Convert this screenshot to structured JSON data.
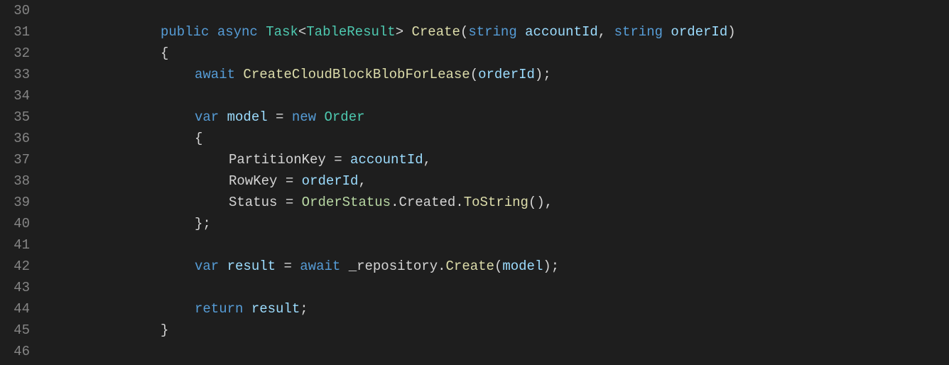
{
  "gutter": {
    "start": 30,
    "end": 46
  },
  "code": {
    "lines": [
      {
        "indent": "indent1",
        "tokens": []
      },
      {
        "indent": "indent1",
        "tokens": [
          {
            "t": "public",
            "c": "tok-keyword"
          },
          {
            "t": " ",
            "c": "tok-default"
          },
          {
            "t": "async",
            "c": "tok-keyword"
          },
          {
            "t": " ",
            "c": "tok-default"
          },
          {
            "t": "Task",
            "c": "tok-type"
          },
          {
            "t": "<",
            "c": "tok-default"
          },
          {
            "t": "TableResult",
            "c": "tok-type"
          },
          {
            "t": "> ",
            "c": "tok-default"
          },
          {
            "t": "Create",
            "c": "tok-method"
          },
          {
            "t": "(",
            "c": "tok-default"
          },
          {
            "t": "string",
            "c": "tok-keyword"
          },
          {
            "t": " ",
            "c": "tok-default"
          },
          {
            "t": "accountId",
            "c": "tok-param"
          },
          {
            "t": ", ",
            "c": "tok-default"
          },
          {
            "t": "string",
            "c": "tok-keyword"
          },
          {
            "t": " ",
            "c": "tok-default"
          },
          {
            "t": "orderId",
            "c": "tok-param"
          },
          {
            "t": ")",
            "c": "tok-default"
          }
        ]
      },
      {
        "indent": "indent1",
        "tokens": [
          {
            "t": "{",
            "c": "tok-default"
          }
        ]
      },
      {
        "indent": "indent2",
        "tokens": [
          {
            "t": "await",
            "c": "tok-keyword"
          },
          {
            "t": " ",
            "c": "tok-default"
          },
          {
            "t": "CreateCloudBlockBlobForLease",
            "c": "tok-method"
          },
          {
            "t": "(",
            "c": "tok-default"
          },
          {
            "t": "orderId",
            "c": "tok-param"
          },
          {
            "t": ");",
            "c": "tok-default"
          }
        ]
      },
      {
        "indent": "indent2",
        "tokens": []
      },
      {
        "indent": "indent2",
        "tokens": [
          {
            "t": "var",
            "c": "tok-keyword"
          },
          {
            "t": " ",
            "c": "tok-default"
          },
          {
            "t": "model",
            "c": "tok-var"
          },
          {
            "t": " = ",
            "c": "tok-default"
          },
          {
            "t": "new",
            "c": "tok-keyword"
          },
          {
            "t": " ",
            "c": "tok-default"
          },
          {
            "t": "Order",
            "c": "tok-type"
          }
        ]
      },
      {
        "indent": "indent2",
        "tokens": [
          {
            "t": "{",
            "c": "tok-default"
          }
        ]
      },
      {
        "indent": "indent3",
        "tokens": [
          {
            "t": "PartitionKey",
            "c": "tok-prop"
          },
          {
            "t": " = ",
            "c": "tok-default"
          },
          {
            "t": "accountId",
            "c": "tok-param"
          },
          {
            "t": ",",
            "c": "tok-default"
          }
        ]
      },
      {
        "indent": "indent3",
        "tokens": [
          {
            "t": "RowKey",
            "c": "tok-prop"
          },
          {
            "t": " = ",
            "c": "tok-default"
          },
          {
            "t": "orderId",
            "c": "tok-param"
          },
          {
            "t": ",",
            "c": "tok-default"
          }
        ]
      },
      {
        "indent": "indent3",
        "tokens": [
          {
            "t": "Status",
            "c": "tok-prop"
          },
          {
            "t": " = ",
            "c": "tok-default"
          },
          {
            "t": "OrderStatus",
            "c": "tok-enum"
          },
          {
            "t": ".",
            "c": "tok-default"
          },
          {
            "t": "Created",
            "c": "tok-prop"
          },
          {
            "t": ".",
            "c": "tok-default"
          },
          {
            "t": "ToString",
            "c": "tok-method"
          },
          {
            "t": "(),",
            "c": "tok-default"
          }
        ]
      },
      {
        "indent": "indent2",
        "tokens": [
          {
            "t": "};",
            "c": "tok-default"
          }
        ]
      },
      {
        "indent": "indent2",
        "tokens": []
      },
      {
        "indent": "indent2",
        "tokens": [
          {
            "t": "var",
            "c": "tok-keyword"
          },
          {
            "t": " ",
            "c": "tok-default"
          },
          {
            "t": "result",
            "c": "tok-var"
          },
          {
            "t": " = ",
            "c": "tok-default"
          },
          {
            "t": "await",
            "c": "tok-keyword"
          },
          {
            "t": " ",
            "c": "tok-default"
          },
          {
            "t": "_repository",
            "c": "tok-field"
          },
          {
            "t": ".",
            "c": "tok-default"
          },
          {
            "t": "Create",
            "c": "tok-method"
          },
          {
            "t": "(",
            "c": "tok-default"
          },
          {
            "t": "model",
            "c": "tok-param"
          },
          {
            "t": ");",
            "c": "tok-default"
          }
        ]
      },
      {
        "indent": "indent2",
        "tokens": []
      },
      {
        "indent": "indent2",
        "tokens": [
          {
            "t": "return",
            "c": "tok-keyword"
          },
          {
            "t": " ",
            "c": "tok-default"
          },
          {
            "t": "result",
            "c": "tok-var"
          },
          {
            "t": ";",
            "c": "tok-default"
          }
        ]
      },
      {
        "indent": "indent1",
        "tokens": [
          {
            "t": "}",
            "c": "tok-default"
          }
        ]
      },
      {
        "indent": "indent1",
        "tokens": []
      }
    ]
  }
}
